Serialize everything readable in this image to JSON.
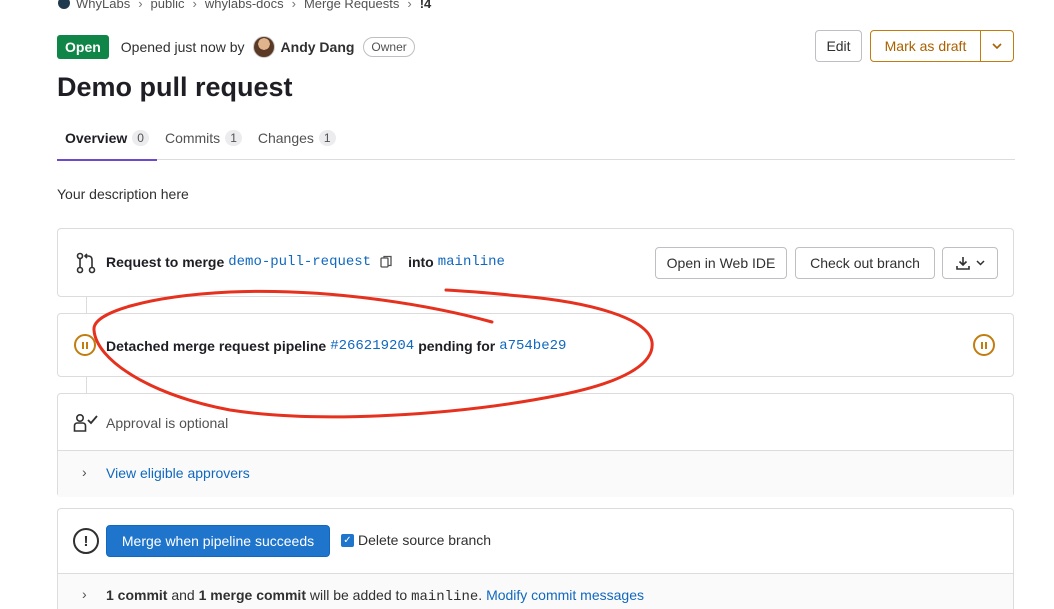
{
  "breadcrumb": {
    "items": [
      "WhyLabs",
      "public",
      "whylabs-docs",
      "Merge Requests",
      "!4"
    ]
  },
  "header": {
    "status": "Open",
    "opened_text": "Opened just now by",
    "author": "Andy Dang",
    "author_role": "Owner",
    "edit_label": "Edit",
    "draft_label": "Mark as draft"
  },
  "title": "Demo pull request",
  "tabs": [
    {
      "label": "Overview",
      "count": "0"
    },
    {
      "label": "Commits",
      "count": "1"
    },
    {
      "label": "Changes",
      "count": "1"
    }
  ],
  "description": "Your description here",
  "merge_info": {
    "prefix": "Request to merge",
    "source_branch": "demo-pull-request",
    "into": "into",
    "target_branch": "mainline",
    "web_ide_label": "Open in Web IDE",
    "checkout_label": "Check out branch"
  },
  "pipeline": {
    "prefix": "Detached merge request pipeline",
    "id": "#266219204",
    "middle": "pending for",
    "commit": "a754be29"
  },
  "approval": {
    "text": "Approval is optional",
    "link": "View eligible approvers"
  },
  "merge": {
    "button_label": "Merge when pipeline succeeds",
    "checkbox_label": "Delete source branch",
    "checkbox_checked": true,
    "summary": {
      "commit_count": "1 commit",
      "and": "and",
      "merge_commit": "1 merge commit",
      "will_be_added": "will be added to",
      "branch": "mainline",
      "period": ".",
      "modify_link": "Modify commit messages"
    }
  },
  "colors": {
    "open_badge": "#108548",
    "link": "#1068bf",
    "primary_button": "#1f75cb",
    "warning": "#c17d10",
    "annotation": "#e5311e"
  }
}
